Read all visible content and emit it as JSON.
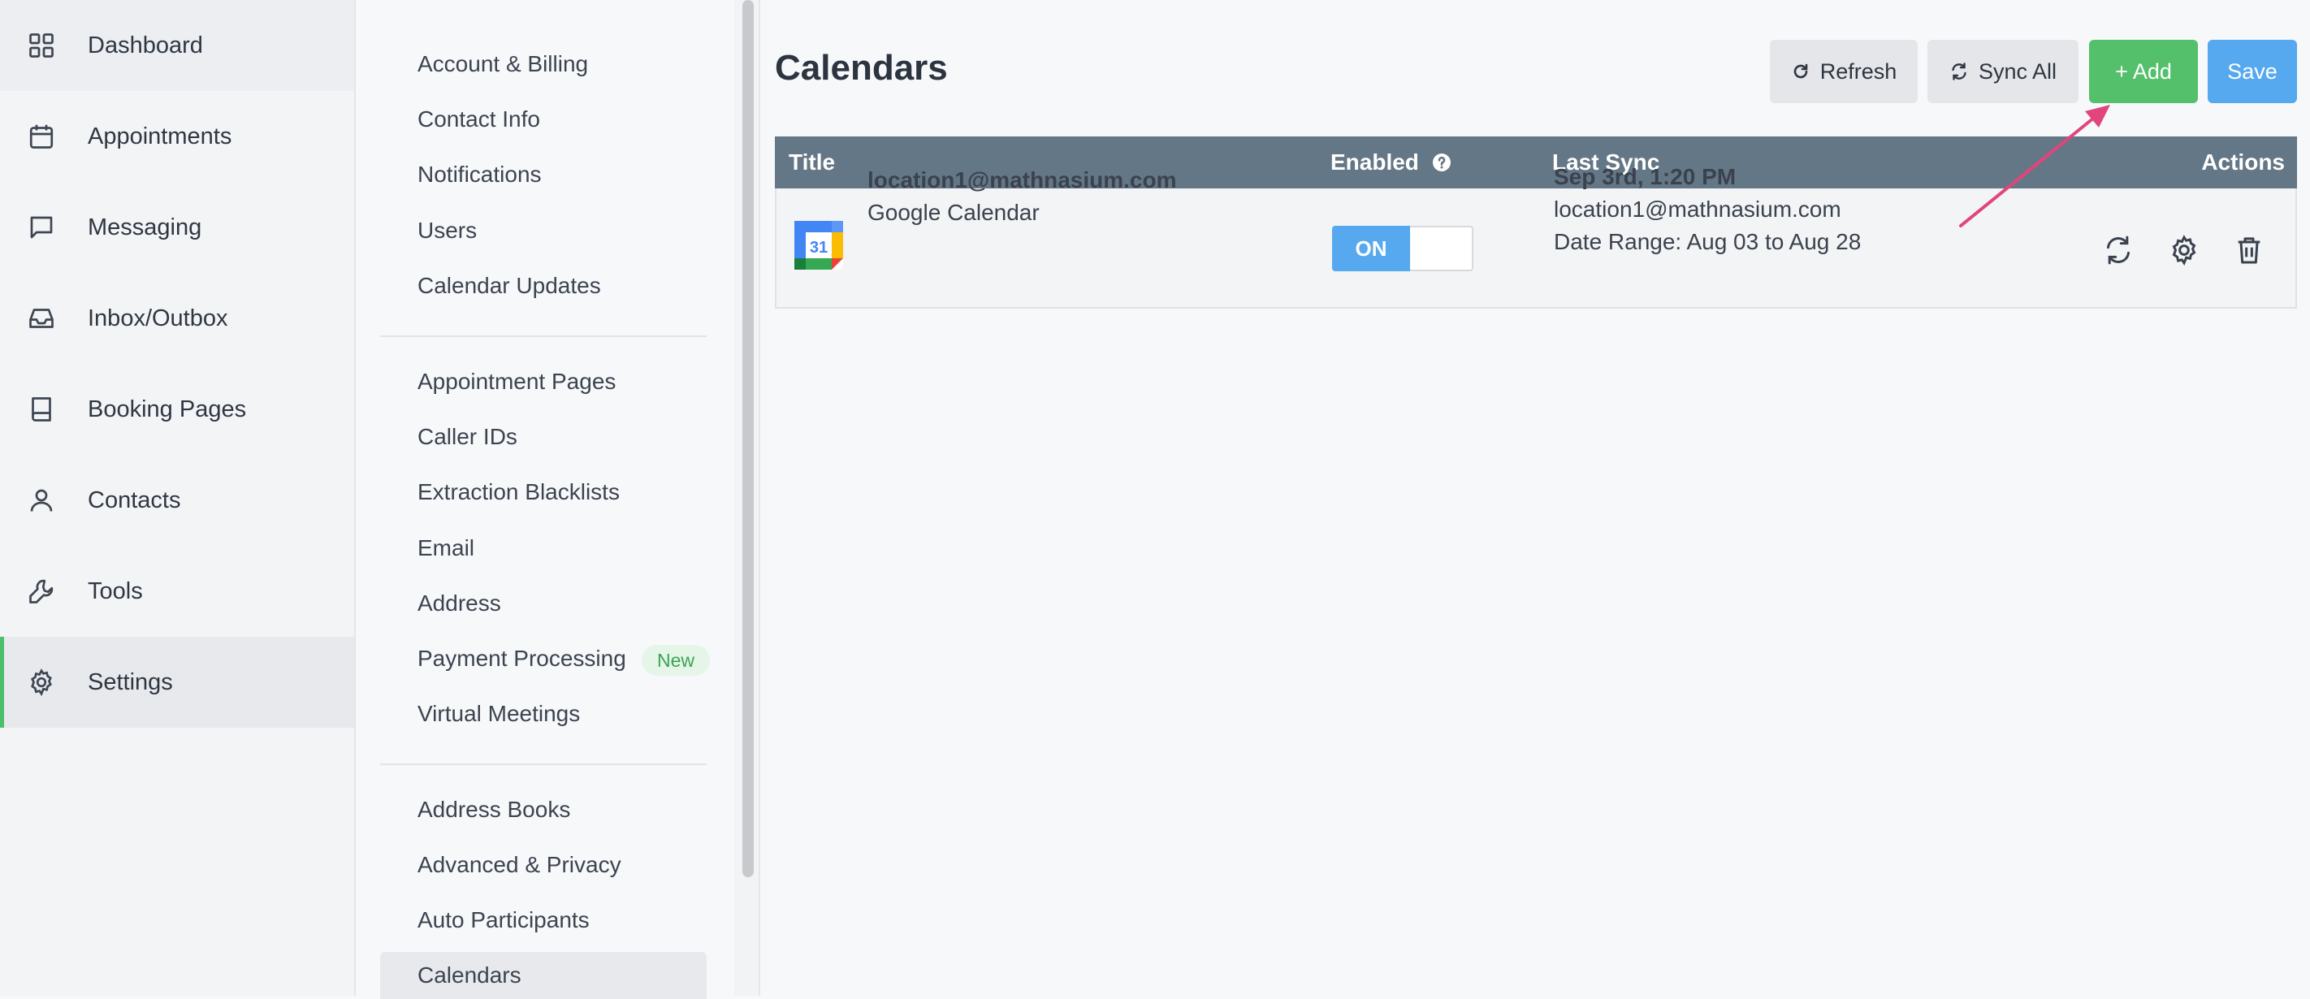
{
  "nav": {
    "items": [
      {
        "label": "Dashboard",
        "icon": "grid-icon"
      },
      {
        "label": "Appointments",
        "icon": "calendar-icon"
      },
      {
        "label": "Messaging",
        "icon": "chat-icon"
      },
      {
        "label": "Inbox/Outbox",
        "icon": "inbox-icon"
      },
      {
        "label": "Booking Pages",
        "icon": "book-icon"
      },
      {
        "label": "Contacts",
        "icon": "user-icon"
      },
      {
        "label": "Tools",
        "icon": "wrench-icon"
      },
      {
        "label": "Settings",
        "icon": "gear-icon"
      }
    ],
    "active": "Settings",
    "accent_color": "#4bbf6b"
  },
  "settings_menu": {
    "group1": [
      "Account & Billing",
      "Contact Info",
      "Notifications",
      "Users",
      "Calendar Updates"
    ],
    "group2": [
      "Appointment Pages",
      "Caller IDs",
      "Extraction Blacklists",
      "Email",
      "Address",
      "Payment Processing",
      "Virtual Meetings"
    ],
    "payment_badge": "New",
    "group3": [
      "Address Books",
      "Advanced & Privacy",
      "Auto Participants",
      "Calendars"
    ],
    "active": "Calendars"
  },
  "main": {
    "title": "Calendars",
    "buttons": {
      "refresh": "Refresh",
      "sync_all": "Sync All",
      "add": "+ Add",
      "save": "Save"
    },
    "table": {
      "headers": {
        "title": "Title",
        "enabled": "Enabled",
        "last_sync": "Last Sync",
        "actions": "Actions"
      },
      "rows": [
        {
          "account": "location1@mathnasium.com",
          "provider": "Google Calendar",
          "enabled": true,
          "toggle_label": "ON",
          "sync_time": "Sep 3rd, 1:20 PM",
          "sync_account": "location1@mathnasium.com",
          "date_range": "Date Range: Aug 03 to Aug 28",
          "actions": [
            "sync-icon",
            "gear-icon",
            "trash-icon"
          ]
        }
      ]
    }
  },
  "colors": {
    "header_bg": "#647786",
    "add_button": "#55c06b",
    "save_button": "#56a8ef",
    "annotation_arrow": "#e0457b"
  }
}
